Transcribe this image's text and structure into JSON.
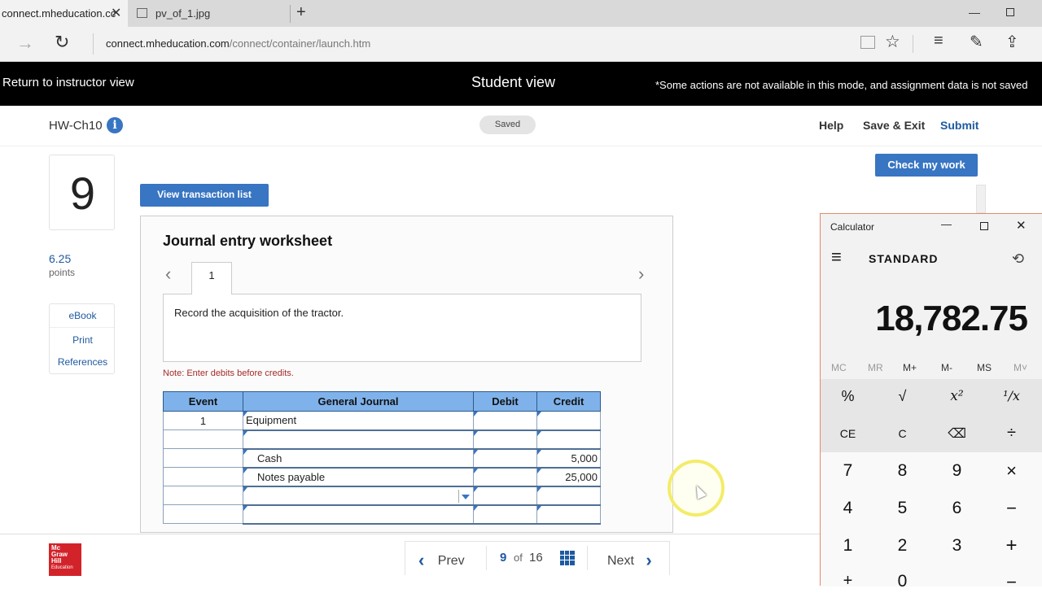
{
  "browser": {
    "tabs": [
      {
        "label": "connect.mheducation.cc",
        "active": true
      },
      {
        "label": "pv_of_1.jpg",
        "active": false
      }
    ],
    "url_domain": "connect.mheducation.com",
    "url_path": "/connect/container/launch.htm"
  },
  "banner": {
    "return_label": "Return to instructor view",
    "center_label": "Student view",
    "notice": "*Some actions are not available in this mode, and assignment data is not saved"
  },
  "header": {
    "assignment": "HW-Ch10",
    "saved_badge": "Saved",
    "help": "Help",
    "save_exit": "Save & Exit",
    "submit": "Submit",
    "check_work": "Check my work"
  },
  "question": {
    "number": "9",
    "points": "6.25",
    "points_label": "points",
    "links": [
      "eBook",
      "Print",
      "References"
    ]
  },
  "worksheet": {
    "view_list_button": "View transaction list",
    "title": "Journal entry worksheet",
    "tab": "1",
    "instruction": "Record the acquisition of the tractor.",
    "note": "Note: Enter debits before credits.",
    "columns": [
      "Event",
      "General Journal",
      "Debit",
      "Credit"
    ],
    "rows": [
      {
        "event": "1",
        "account": "Equipment",
        "debit": "",
        "credit": ""
      },
      {
        "event": "",
        "account": "",
        "debit": "",
        "credit": ""
      },
      {
        "event": "",
        "account": "Cash",
        "debit": "",
        "credit": "5,000"
      },
      {
        "event": "",
        "account": "Notes payable",
        "debit": "",
        "credit": "25,000"
      },
      {
        "event": "",
        "account": "",
        "debit": "",
        "credit": ""
      },
      {
        "event": "",
        "account": "",
        "debit": "",
        "credit": ""
      }
    ]
  },
  "pager": {
    "prev": "Prev",
    "current": "9",
    "of": "of",
    "total": "16",
    "next": "Next"
  },
  "logo": {
    "lines": [
      "Mc",
      "Graw",
      "Hill",
      "Education"
    ]
  },
  "calculator": {
    "title": "Calculator",
    "mode": "STANDARD",
    "display": "18,782.75",
    "memory": [
      "MC",
      "MR",
      "M+",
      "M-",
      "MS",
      "M˅"
    ],
    "row1": [
      "%",
      "√",
      "x²",
      "¹/x"
    ],
    "row2": [
      "CE",
      "C",
      "⌫",
      "÷"
    ],
    "row3": [
      "7",
      "8",
      "9",
      "×"
    ],
    "row4": [
      "4",
      "5",
      "6",
      "−"
    ],
    "row5": [
      "1",
      "2",
      "3",
      "+"
    ],
    "row6": [
      "+",
      "0",
      "",
      "−"
    ]
  },
  "colors": {
    "accent": "#3875c2",
    "header_blue": "#7fb2ea",
    "note_red": "#a52a2a",
    "logo_red": "#d2232a"
  }
}
